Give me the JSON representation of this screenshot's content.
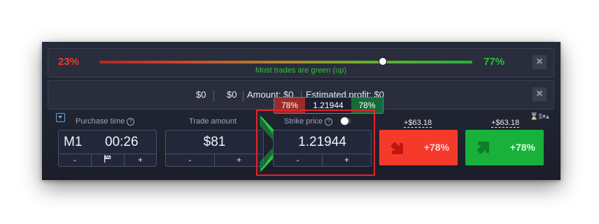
{
  "sentiment": {
    "left_percent": "23%",
    "right_percent": "77%",
    "caption": "Most trades are green (up)",
    "level": 0.77
  },
  "summary": {
    "value1": "$0",
    "value2": "$0",
    "amount_label": "Amount: $0",
    "profit_label": "Estimated profit: $0"
  },
  "close_glyph": "×",
  "purchase_time": {
    "label": "Purchase time",
    "timeframe": "M1",
    "time": "00:26",
    "minus": "-",
    "plus": "+"
  },
  "trade_amount": {
    "label": "Trade amount",
    "value": "$81",
    "minus": "-",
    "plus": "+"
  },
  "strike_price": {
    "label": "Strike price",
    "value": "1.21944",
    "minus": "-",
    "plus": "+",
    "tooltip": {
      "left_percent": "78%",
      "price": "1.21944",
      "right_percent": "78%"
    }
  },
  "payouts": {
    "sell_payout": "+$63.18",
    "buy_payout": "+$63.18",
    "currency_switch": "⌛$▾▴"
  },
  "buttons": {
    "sell_label": "+78%",
    "buy_label": "+78%"
  },
  "colors": {
    "panel_bg": "#1f2230",
    "red": "#f53a2c",
    "green": "#18b23b",
    "highlight_border": "#e0262a",
    "label_blue": "#9aa6c4"
  }
}
